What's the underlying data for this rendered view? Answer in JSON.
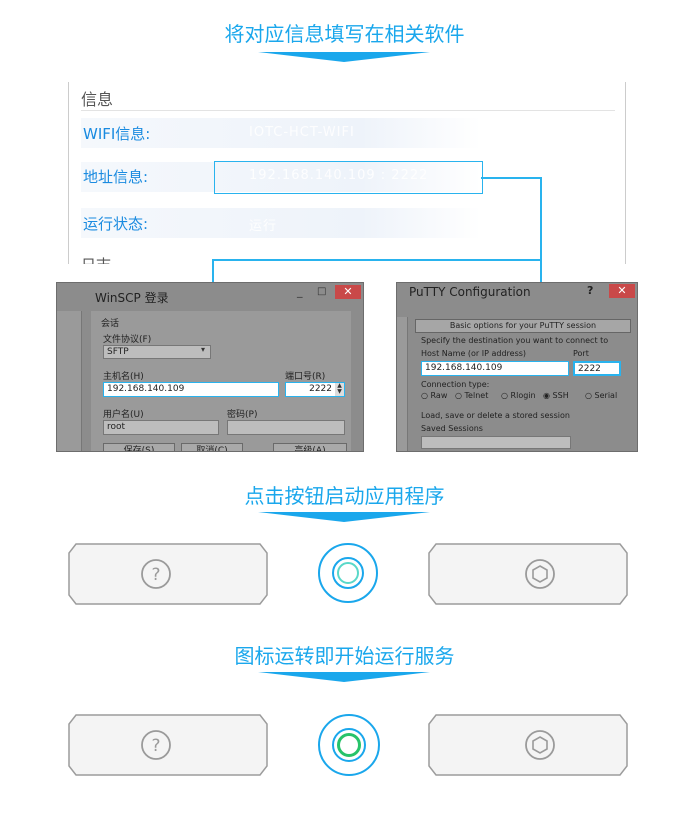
{
  "step1": {
    "title": "将对应信息填写在相关软件"
  },
  "info": {
    "header": "信息",
    "wifi_label": "WIFI信息:",
    "wifi_value": "IOTC-HCT-WIFI",
    "addr_label": "地址信息:",
    "addr_value": "192.168.140.109 : 2222",
    "status_label": "运行状态:",
    "status_value": "运行",
    "log_label": "日志"
  },
  "winscp": {
    "title": "WinSCP 登录",
    "minimize": "_",
    "maximize": "□",
    "close": "✕",
    "session_label": "会话",
    "protocol_label": "文件协议(F)",
    "protocol_value": "SFTP",
    "host_label": "主机名(H)",
    "host_value": "192.168.140.109",
    "port_label": "端口号(R)",
    "port_value": "2222",
    "user_label": "用户名(U)",
    "user_value": "root",
    "password_label": "密码(P)",
    "save_btn": "保存(S)",
    "cancel_btn": "取消(C)",
    "advanced_btn": "高级(A)"
  },
  "putty": {
    "title": "PuTTY Configuration",
    "help": "?",
    "close": "✕",
    "section": "Basic options for your PuTTY session",
    "dest_label": "Specify the destination you want to connect to",
    "host_label": "Host Name (or IP address)",
    "port_label": "Port",
    "host_value": "192.168.140.109",
    "port_value": "2222",
    "conn_label": "Connection type:",
    "conn_options": [
      "Raw",
      "Telnet",
      "Rlogin",
      "SSH",
      "Serial"
    ],
    "conn_selected": "SSH",
    "load_label": "Load, save or delete a stored session",
    "saved_label": "Saved Sessions"
  },
  "step2": {
    "title": "点击按钮启动应用程序"
  },
  "step3": {
    "title": "图标运转即开始运行服务"
  },
  "colors": {
    "accent": "#1aa7ec",
    "active_ring": "#27c36a"
  }
}
